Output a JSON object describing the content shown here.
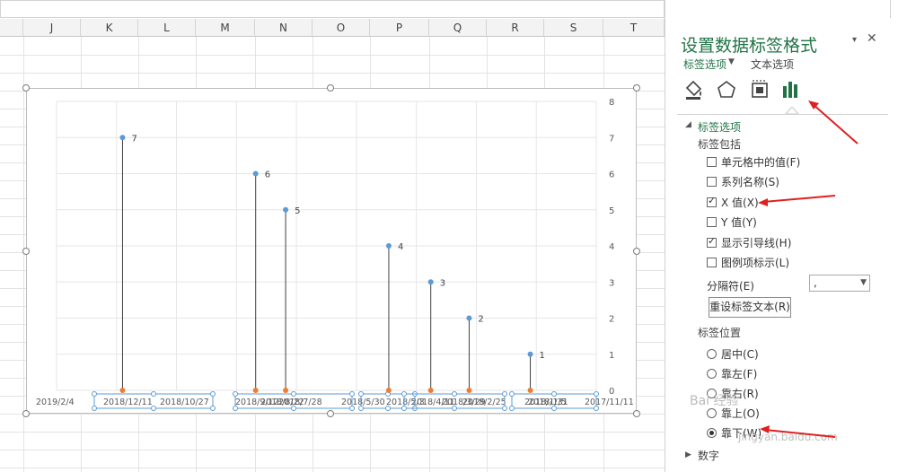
{
  "columns": [
    "J",
    "K",
    "L",
    "M",
    "N",
    "O",
    "P",
    "Q",
    "R",
    "S",
    "T"
  ],
  "chart": {
    "y_ticks": [
      "8",
      "7",
      "6",
      "5",
      "4",
      "3",
      "2",
      "1",
      "0"
    ],
    "x_labels": [
      "2019/2/4",
      "2018/12/11",
      "2018/10/27",
      "2018/9/12",
      "2018/8/22",
      "2018/7/28",
      "2018/5/30",
      "2018/5/3",
      "2018/4/11",
      "2018/3/29",
      "2018/2/25",
      "2018/1/31",
      "2018/1/5",
      "2017/11/11"
    ],
    "point_labels": [
      "7",
      "6",
      "5",
      "4",
      "3",
      "2",
      "1"
    ]
  },
  "chart_data": {
    "type": "scatter",
    "y_ticks": [
      0,
      1,
      2,
      3,
      4,
      5,
      6,
      7,
      8
    ],
    "ylim": [
      0,
      8
    ],
    "x_tick_labels": [
      "2019/2/4",
      "2018/10/27",
      "2018/5/30",
      "2017/11/11"
    ],
    "points": [
      {
        "x": "2018/12/11",
        "y": 7,
        "label": "7"
      },
      {
        "x": "2018/8/22",
        "y": 6,
        "label": "6"
      },
      {
        "x": "2018/7/28",
        "y": 5,
        "label": "5"
      },
      {
        "x": "2018/5/3",
        "y": 4,
        "label": "4"
      },
      {
        "x": "2018/3/29",
        "y": 3,
        "label": "3"
      },
      {
        "x": "2018/2/25",
        "y": 2,
        "label": "2"
      },
      {
        "x": "2018/1/5",
        "y": 1,
        "label": "1"
      }
    ],
    "series_colors": {
      "top": "#5b9bd5",
      "base": "#ed7d31"
    }
  },
  "panel": {
    "title": "设置数据标签格式",
    "close": "✕",
    "dropdown": "▾",
    "tab_label_options": "标签选项",
    "tab_text_options": "文本选项",
    "tab_arrow": "▼",
    "section_label_options": "标签选项",
    "section_caret": "◢",
    "label_contains": "标签包括",
    "options": [
      {
        "label": "单元格中的值(F)",
        "checked": false
      },
      {
        "label": "系列名称(S)",
        "checked": false
      },
      {
        "label": "X 值(X)",
        "checked": true
      },
      {
        "label": "Y 值(Y)",
        "checked": false
      },
      {
        "label": "显示引导线(H)",
        "checked": true
      },
      {
        "label": "图例项标示(L)",
        "checked": false
      }
    ],
    "separator_label": "分隔符(E)",
    "separator_value": ",",
    "separator_arrow": "▼",
    "reset_button": "重设标签文本(R)",
    "label_position": "标签位置",
    "positions": [
      {
        "label": "居中(C)",
        "checked": false
      },
      {
        "label": "靠左(F)",
        "checked": false
      },
      {
        "label": "靠右(R)",
        "checked": false
      },
      {
        "label": "靠上(O)",
        "checked": false
      },
      {
        "label": "靠下(W)",
        "checked": true
      }
    ],
    "number_section_caret": "▶",
    "number_section": "数字"
  },
  "watermark": {
    "text": "Bai 经验",
    "url": "jingyan.baidu.com"
  },
  "colors": {
    "accent": "#217346",
    "arrow": "#e02020"
  }
}
